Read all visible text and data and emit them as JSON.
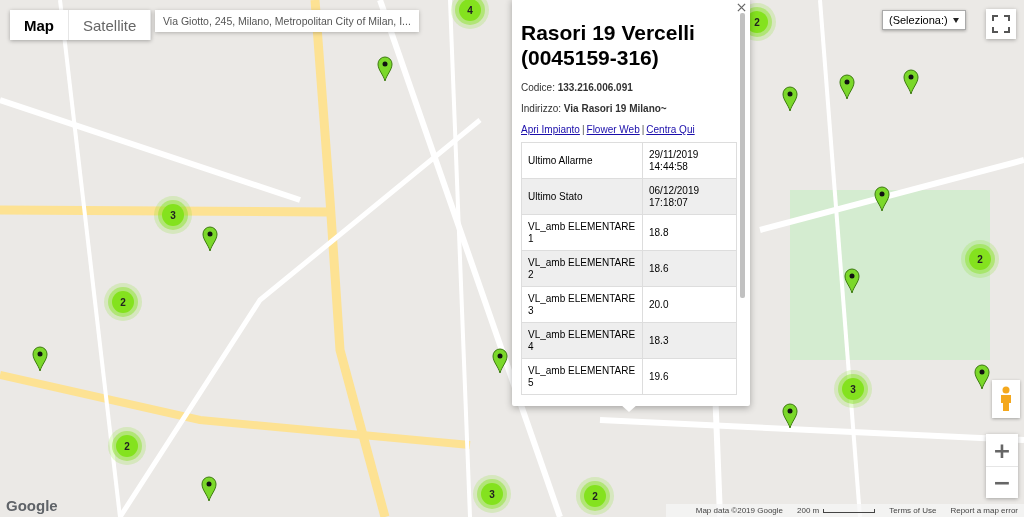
{
  "map_type_control": {
    "tabs": [
      {
        "label": "Map",
        "selected": true
      },
      {
        "label": "Satellite",
        "selected": false
      }
    ]
  },
  "address_box": {
    "text": "Via Giotto, 245, Milano, Metropolitan City of Milan, I..."
  },
  "select": {
    "value": "(Seleziona:)"
  },
  "popup": {
    "title": "Rasori 19 Vercelli (0045159-316)",
    "codice_label": "Codice:",
    "codice": "133.216.006.091",
    "indirizzo_label": "Indirizzo:",
    "indirizzo": "Via Rasori 19 Milano~",
    "links": [
      "Apri Impianto",
      "Flower Web",
      "Centra Qui"
    ],
    "link_separator": "|",
    "rows": [
      {
        "label": "Ultimo Allarme",
        "value": "29/11/2019 14:44:58"
      },
      {
        "label": "Ultimo Stato",
        "value": "06/12/2019 17:18:07"
      },
      {
        "label": "VL_amb ELEMENTARE 1",
        "value": "18.8"
      },
      {
        "label": "VL_amb ELEMENTARE 2",
        "value": "18.6"
      },
      {
        "label": "VL_amb ELEMENTARE 3",
        "value": "20.0"
      },
      {
        "label": "VL_amb ELEMENTARE 4",
        "value": "18.3"
      },
      {
        "label": "VL_amb ELEMENTARE 5",
        "value": "19.6"
      }
    ]
  },
  "clusters": [
    {
      "count": "4"
    },
    {
      "count": "2"
    },
    {
      "count": "3"
    },
    {
      "count": "2"
    },
    {
      "count": "2"
    },
    {
      "count": "3"
    },
    {
      "count": "2"
    },
    {
      "count": "3"
    },
    {
      "count": "2"
    }
  ],
  "zoom": {
    "in": "+",
    "out": "−"
  },
  "footer": {
    "map_data": "Map data ©2019 Google",
    "scale": "200 m",
    "terms": "Terms of Use",
    "report": "Report a map error"
  },
  "logo": "Google"
}
